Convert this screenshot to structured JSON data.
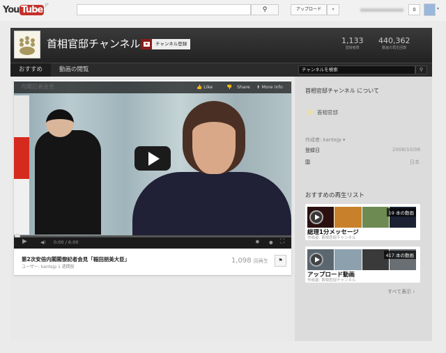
{
  "topbar": {
    "logo_you": "You",
    "logo_tube": "Tube",
    "logo_region": "JP",
    "search_placeholder": "",
    "search_icon": "search-icon",
    "upload_label": "アップロード",
    "upload_dropdown": "▾",
    "notifications": "0"
  },
  "channel": {
    "title": "首相官邸チャンネル",
    "subscribe_label": "チャンネル登録",
    "stats": [
      {
        "value": "1,133",
        "label": "登録者数"
      },
      {
        "value": "440,362",
        "label": "動画の再生回数"
      }
    ],
    "tabs": [
      {
        "label": "おすすめ"
      },
      {
        "label": "動画の閲覧"
      }
    ],
    "search_placeholder": "チャンネルを検索"
  },
  "video": {
    "overlay_title": "内閣記者会見",
    "like": "Like",
    "dislike": "",
    "share": "Share",
    "more_info": "More info",
    "time": "0:00 / 6:00",
    "progress": 0,
    "title": "第2次安倍内閣閣僚記者会見「稲田朋美大臣」",
    "byline": "ユーザー: kantejp 1 週間前",
    "views": "1,098",
    "views_label": "回再生"
  },
  "about": {
    "heading": "首相官邸チャンネル について",
    "link": "首相官邸",
    "creator": "作成者: kantejp",
    "joined_label": "登録日",
    "joined_value": "2008/10/06",
    "country_label": "国",
    "country_value": "日本"
  },
  "playlists": {
    "heading": "おすすめの再生リスト",
    "items": [
      {
        "title": "総理1分メッセージ",
        "by": "作成者: 首相官邸チャンネル",
        "count": "19 本の動画"
      },
      {
        "title": "アップロード動画",
        "by": "作成者: 首相官邸チャンネル",
        "count": "417 本の動画"
      }
    ],
    "show_all": "すべて表示 ›"
  }
}
